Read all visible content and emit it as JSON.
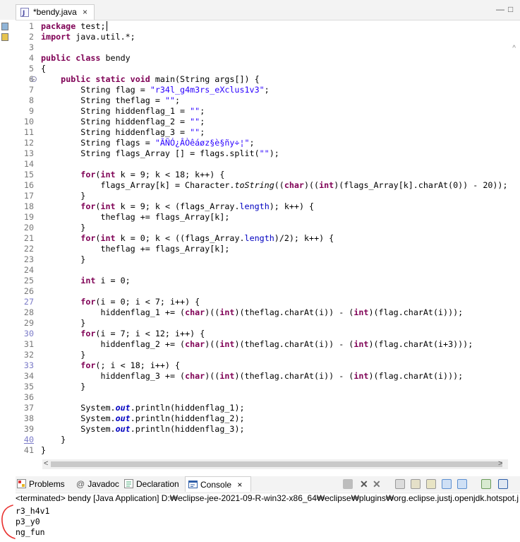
{
  "editor_tab": {
    "title": "*bendy.java",
    "close": "×"
  },
  "window_buttons": {
    "minimize": "—",
    "maximize": "□"
  },
  "code_lines": [
    {
      "n": "1",
      "html": "<span class='kw'>package</span> test;"
    },
    {
      "n": "2",
      "html": "<span class='kw'>import</span> java.util.*;"
    },
    {
      "n": "3",
      "html": ""
    },
    {
      "n": "4",
      "html": "<span class='kw'>public class</span> bendy"
    },
    {
      "n": "5",
      "html": "{"
    },
    {
      "n": "6",
      "html": "    <span class='kw'>public static void</span> main(String args[]) {"
    },
    {
      "n": "7",
      "html": "        String flag = <span class='str'>\"r34l_g4m3rs_eXclus1v3\"</span>;"
    },
    {
      "n": "8",
      "html": "        String theflag = <span class='str'>\"\"</span>;"
    },
    {
      "n": "9",
      "html": "        String hiddenflag_1 = <span class='str'>\"\"</span>;"
    },
    {
      "n": "10",
      "html": "        String hiddenflag_2 = <span class='str'>\"\"</span>;"
    },
    {
      "n": "11",
      "html": "        String hiddenflag_3 = <span class='str'>\"\"</span>;"
    },
    {
      "n": "12",
      "html": "        String flags = <span class='str'>\"ÃÑÓ¿ÂÒêáøz§è§ñy÷¦\"</span>;"
    },
    {
      "n": "13",
      "html": "        String flags_Array [] = flags.split(<span class='str'>\"\"</span>);"
    },
    {
      "n": "14",
      "html": ""
    },
    {
      "n": "15",
      "html": "        <span class='kw'>for</span>(<span class='kw'>int</span> k = 9; k &lt; 18; k++) {"
    },
    {
      "n": "16",
      "html": "            flags_Array[k] = Character.<span class='ital'>toString</span>((<span class='kw'>char</span>)((<span class='kw'>int</span>)(flags_Array[k].charAt(0)) - 20));"
    },
    {
      "n": "17",
      "html": "        }"
    },
    {
      "n": "18",
      "html": "        <span class='kw'>for</span>(<span class='kw'>int</span> k = 9; k &lt; (flags_Array.<span class='fld' style='font-style:normal;font-weight:normal'>length</span>); k++) {"
    },
    {
      "n": "19",
      "html": "            theflag += flags_Array[k];"
    },
    {
      "n": "20",
      "html": "        }"
    },
    {
      "n": "21",
      "html": "        <span class='kw'>for</span>(<span class='kw'>int</span> k = 0; k &lt; ((flags_Array.<span class='fld' style='font-style:normal;font-weight:normal'>length</span>)/2); k++) {"
    },
    {
      "n": "22",
      "html": "            theflag += flags_Array[k];"
    },
    {
      "n": "23",
      "html": "        }"
    },
    {
      "n": "24",
      "html": ""
    },
    {
      "n": "25",
      "html": "        <span class='kw'>int</span> i = 0;"
    },
    {
      "n": "26",
      "html": ""
    },
    {
      "n": "27",
      "html": "        <span class='kw'>for</span>(i = 0; i &lt; 7; i++) {"
    },
    {
      "n": "28",
      "html": "            hiddenflag_1 += (<span class='kw'>char</span>)((<span class='kw'>int</span>)(theflag.charAt(i)) - (<span class='kw'>int</span>)(flag.charAt(i)));"
    },
    {
      "n": "29",
      "html": "        }"
    },
    {
      "n": "30",
      "html": "        <span class='kw'>for</span>(i = 7; i &lt; 12; i++) {"
    },
    {
      "n": "31",
      "html": "            hiddenflag_2 += (<span class='kw'>char</span>)((<span class='kw'>int</span>)(theflag.charAt(i)) - (<span class='kw'>int</span>)(flag.charAt(i+3)));"
    },
    {
      "n": "32",
      "html": "        }"
    },
    {
      "n": "33",
      "html": "        <span class='kw'>for</span>(; i &lt; 18; i++) {"
    },
    {
      "n": "34",
      "html": "            hiddenflag_3 += (<span class='kw'>char</span>)((<span class='kw'>int</span>)(theflag.charAt(i)) - (<span class='kw'>int</span>)(flag.charAt(i)));"
    },
    {
      "n": "35",
      "html": "        }"
    },
    {
      "n": "36",
      "html": ""
    },
    {
      "n": "37",
      "html": "        System.<span class='fld'>out</span>.println(hiddenflag_1);"
    },
    {
      "n": "38",
      "html": "        System.<span class='fld'>out</span>.println(hiddenflag_2);"
    },
    {
      "n": "39",
      "html": "        System.<span class='fld'>out</span>.println(hiddenflag_3);"
    },
    {
      "n": "40",
      "html": "    }"
    },
    {
      "n": "41",
      "html": "}"
    }
  ],
  "panel_tabs": {
    "problems": "Problems",
    "javadoc": "Javadoc",
    "declaration": "Declaration",
    "console": "Console",
    "console_close": "×"
  },
  "console": {
    "header": "<terminated> bendy [Java Application] D:₩eclipse-jee-2021-09-R-win32-x86_64₩eclipse₩plugins₩org.eclipse.justj.openjdk.hotspot.j",
    "output": [
      "r3_h4v1",
      "p3_y0",
      "ng_fun"
    ]
  },
  "colors": {
    "keyword": "#7f0055",
    "string": "#2a00ff",
    "field": "#0000c0",
    "annotation": "#e8312f"
  }
}
